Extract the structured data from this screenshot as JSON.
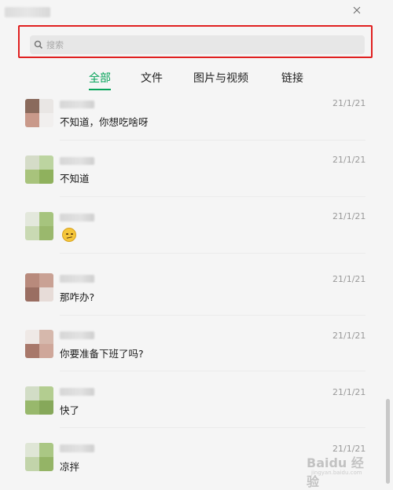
{
  "window": {
    "title_bar": {
      "close_icon": "close-icon"
    }
  },
  "search": {
    "placeholder": "搜索",
    "value": "",
    "icon": "search-icon",
    "highlight_color": "#e02020"
  },
  "tabs": [
    {
      "label": "全部",
      "active": true
    },
    {
      "label": "文件",
      "active": false
    },
    {
      "label": "图片与视频",
      "active": false
    },
    {
      "label": "链接",
      "active": false
    }
  ],
  "accent_color": "#07a35a",
  "messages": [
    {
      "text": "不知道，你想吃啥呀",
      "date": "21/1/21",
      "type": "text"
    },
    {
      "text": "不知道",
      "date": "21/1/21",
      "type": "text"
    },
    {
      "text": "",
      "date": "21/1/21",
      "type": "emoji",
      "emoji": "woozy-face-emoji"
    },
    {
      "text": "那咋办?",
      "date": "21/1/21",
      "type": "text"
    },
    {
      "text": "你要准备下班了吗?",
      "date": "21/1/21",
      "type": "text"
    },
    {
      "text": "快了",
      "date": "21/1/21",
      "type": "text"
    },
    {
      "text": "凉拌",
      "date": "21/1/21",
      "type": "text"
    }
  ],
  "watermark": {
    "main": "Baidu 经验",
    "sub": "jingyan.baidu.com"
  }
}
